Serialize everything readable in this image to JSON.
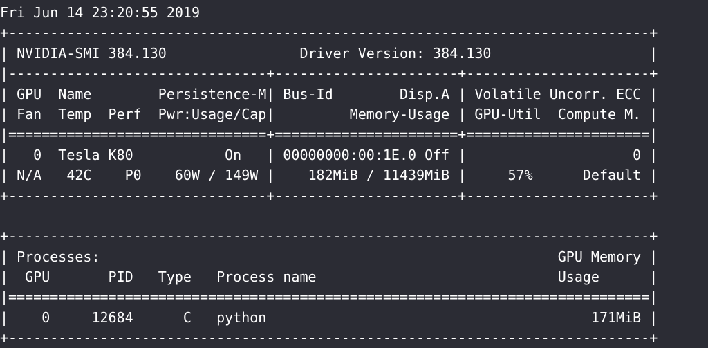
{
  "terminal": {
    "lines": [
      "Fri Jun 14 23:20:55 2019",
      "+-----------------------------------------------------------------------------+",
      "| NVIDIA-SMI 384.130                Driver Version: 384.130                   |",
      "|-------------------------------+----------------------+----------------------+",
      "| GPU  Name        Persistence-M| Bus-Id        Disp.A | Volatile Uncorr. ECC |",
      "| Fan  Temp  Perf  Pwr:Usage/Cap|         Memory-Usage | GPU-Util  Compute M. |",
      "|===============================+======================+======================|",
      "|   0  Tesla K80           On   | 00000000:00:1E.0 Off |                    0 |",
      "| N/A   42C    P0    60W / 149W |    182MiB / 11439MiB |     57%      Default |",
      "+-------------------------------+----------------------+----------------------+",
      "",
      "+-----------------------------------------------------------------------------+",
      "| Processes:                                                       GPU Memory |",
      "|  GPU       PID   Type   Process name                             Usage      |",
      "|=============================================================================|",
      "|    0     12684      C   python                                       171MiB |",
      "+-----------------------------------------------------------------------------+"
    ]
  }
}
